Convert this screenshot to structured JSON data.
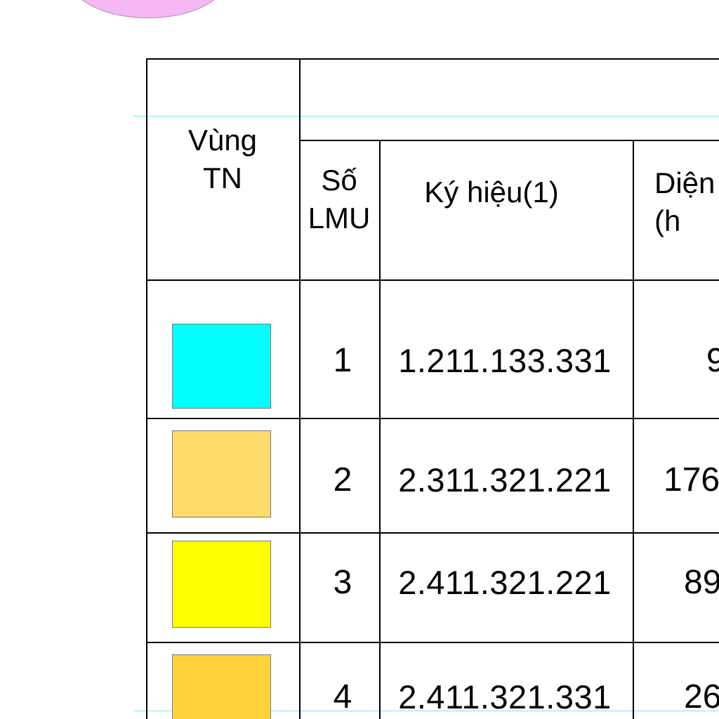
{
  "table": {
    "headers": {
      "zone": "Vùng\nTN",
      "lmu_count": "Số\nLMU",
      "symbol": "Ký hiệu(1)",
      "area": "Diện\n(h"
    },
    "rows": [
      {
        "swatch_color": "#00ffff",
        "lmu": "1",
        "symbol": "1.211.133.331",
        "area": "9"
      },
      {
        "swatch_color": "#ffdb6b",
        "lmu": "2",
        "symbol": "2.311.321.221",
        "area": "176"
      },
      {
        "swatch_color": "#ffff00",
        "lmu": "3",
        "symbol": "2.411.321.221",
        "area": "89"
      },
      {
        "swatch_color": "#ffd23c",
        "lmu": "4",
        "symbol": "2.411.321.331",
        "area": "26"
      }
    ]
  },
  "colors": {
    "guide_lines": "#7fe6ee",
    "map_blob": "#f5b8f5",
    "grid": "#000000"
  }
}
